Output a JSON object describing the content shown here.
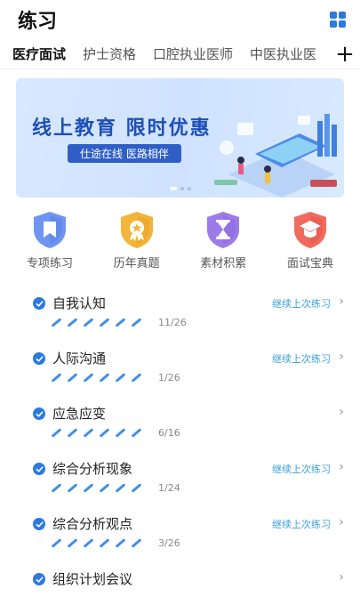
{
  "header": {
    "title": "练习",
    "grid_icon": "grid-icon"
  },
  "tabs": [
    {
      "label": "医疗面试",
      "active": true
    },
    {
      "label": "护士资格",
      "active": false
    },
    {
      "label": "口腔执业医师",
      "active": false
    },
    {
      "label": "中医执业医",
      "active": false
    }
  ],
  "tab_add_label": "+",
  "banner": {
    "title": "线上教育 限时优惠",
    "subtitle": "仕途在线 医路相伴",
    "page_count": 3,
    "active_page": 1
  },
  "features": [
    {
      "label": "专项练习",
      "icon": "bookmark-shield-icon",
      "color": "#6f95f0"
    },
    {
      "label": "历年真题",
      "icon": "medal-shield-icon",
      "color": "#f3b43a"
    },
    {
      "label": "素材积累",
      "icon": "hourglass-shield-icon",
      "color": "#9c7be8"
    },
    {
      "label": "面试宝典",
      "icon": "graduation-cap-shield-icon",
      "color": "#f06b5e"
    }
  ],
  "continue_label": "继续上次练习",
  "list": [
    {
      "title": "自我认知",
      "progress": "11/26",
      "show_continue": true
    },
    {
      "title": "人际沟通",
      "progress": "1/26",
      "show_continue": true
    },
    {
      "title": "应急应变",
      "progress": "6/16",
      "show_continue": false
    },
    {
      "title": "综合分析现象",
      "progress": "1/24",
      "show_continue": true
    },
    {
      "title": "综合分析观点",
      "progress": "3/26",
      "show_continue": true
    },
    {
      "title": "组织计划会议",
      "progress": "",
      "show_continue": false
    }
  ],
  "colors": {
    "accent": "#2d79e0",
    "continue": "#3aa0d8",
    "banner_title": "#1d4fb8"
  }
}
